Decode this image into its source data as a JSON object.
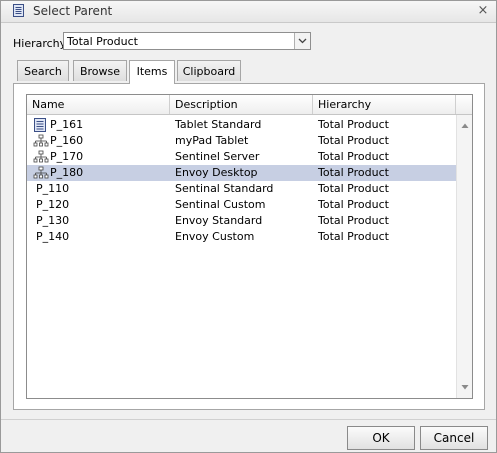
{
  "window": {
    "title": "Select Parent",
    "close_label": "×"
  },
  "hierarchy": {
    "label": "Hierarchy",
    "value": "Total Product"
  },
  "tabs": [
    {
      "label": "Search",
      "active": false
    },
    {
      "label": "Browse",
      "active": false
    },
    {
      "label": "Items",
      "active": true
    },
    {
      "label": "Clipboard",
      "active": false
    }
  ],
  "grid": {
    "columns": [
      "Name",
      "Description",
      "Hierarchy"
    ],
    "rows": [
      {
        "name": "P_161",
        "description": "Tablet Standard",
        "hierarchy": "Total Product",
        "icon": "document-icon",
        "selected": false
      },
      {
        "name": "P_160",
        "description": "myPad Tablet",
        "hierarchy": "Total Product",
        "icon": "hierarchy-tree-icon",
        "selected": false
      },
      {
        "name": "P_170",
        "description": "Sentinel Server",
        "hierarchy": "Total Product",
        "icon": "hierarchy-tree-icon",
        "selected": false
      },
      {
        "name": "P_180",
        "description": "Envoy Desktop",
        "hierarchy": "Total Product",
        "icon": "hierarchy-tree-icon",
        "selected": true
      },
      {
        "name": "P_110",
        "description": "Sentinal Standard",
        "hierarchy": "Total Product",
        "icon": "none",
        "selected": false
      },
      {
        "name": "P_120",
        "description": "Sentinal Custom",
        "hierarchy": "Total Product",
        "icon": "none",
        "selected": false
      },
      {
        "name": "P_130",
        "description": "Envoy Standard",
        "hierarchy": "Total Product",
        "icon": "none",
        "selected": false
      },
      {
        "name": "P_140",
        "description": "Envoy Custom",
        "hierarchy": "Total Product",
        "icon": "none",
        "selected": false
      }
    ]
  },
  "buttons": {
    "ok_label": "OK",
    "cancel_label": "Cancel"
  },
  "colors": {
    "selected_row": "#c7cfe3",
    "dialog_background": "#f0f0f0"
  }
}
